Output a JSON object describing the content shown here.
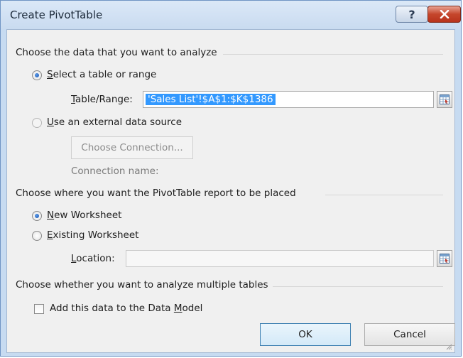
{
  "window": {
    "title": "Create PivotTable",
    "help_glyph": "?",
    "close_glyph": "✕"
  },
  "analyze_section": {
    "heading": "Choose the data that you want to analyze",
    "option_table": {
      "label": "elect a table or range",
      "mnemonic": "S",
      "selected": true
    },
    "table_range": {
      "label": "able/Range:",
      "mnemonic": "T",
      "value": "'Sales List'!$A$1:$K$1386"
    },
    "option_external": {
      "label": "se an external data source",
      "mnemonic": "U",
      "selected": false
    },
    "choose_connection_label": "Choose Connection...",
    "connection_name_label": "Connection name:"
  },
  "placement_section": {
    "heading": "Choose where you want the PivotTable report to be placed",
    "option_new": {
      "label": "ew Worksheet",
      "mnemonic": "N",
      "selected": true
    },
    "option_existing": {
      "label": "xisting Worksheet",
      "mnemonic": "E",
      "selected": false
    },
    "location": {
      "label": "ocation:",
      "mnemonic": "L",
      "value": ""
    }
  },
  "multiple_section": {
    "heading": "Choose whether you want to analyze multiple tables",
    "data_model": {
      "label_before": "Add this data to the Data ",
      "mnemonic": "M",
      "label_after": "odel",
      "checked": false
    }
  },
  "buttons": {
    "ok": "OK",
    "cancel": "Cancel"
  },
  "icons": {
    "range_picker": "range-selector-icon",
    "resize": "resize-grip-icon"
  }
}
